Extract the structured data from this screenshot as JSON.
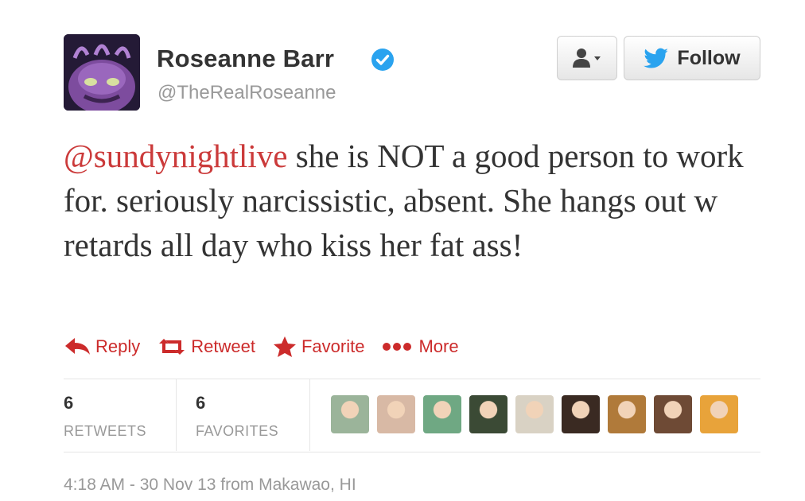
{
  "author": {
    "name": "Roseanne Barr",
    "handle": "@TheRealRoseanne",
    "verified": true,
    "avatar_icon": "purple-monster-avatar"
  },
  "buttons": {
    "user_menu_icon": "user-dropdown-icon",
    "follow_label": "Follow"
  },
  "tweet": {
    "mention": "@sundynightlive",
    "body": " she is NOT a good person to work for. seriously narcissistic, absent. She hangs out w retards all day who kiss her fat ass!"
  },
  "actions": [
    {
      "label": "Reply",
      "icon": "reply-icon"
    },
    {
      "label": "Retweet",
      "icon": "retweet-icon"
    },
    {
      "label": "Favorite",
      "icon": "star-icon"
    },
    {
      "label": "More",
      "icon": "more-dots-icon"
    }
  ],
  "stats": {
    "retweets": {
      "count": "6",
      "label": "RETWEETS"
    },
    "favorites": {
      "count": "6",
      "label": "FAVORITES"
    }
  },
  "favoriters": [
    {
      "name": "avatar-1",
      "color": "#9bb49a"
    },
    {
      "name": "avatar-2",
      "color": "#d8b9a5"
    },
    {
      "name": "avatar-3",
      "color": "#6fa883"
    },
    {
      "name": "avatar-4",
      "color": "#3b4a35"
    },
    {
      "name": "avatar-5",
      "color": "#d9d2c4"
    },
    {
      "name": "avatar-6",
      "color": "#3a2a22"
    },
    {
      "name": "avatar-7",
      "color": "#b07a3a"
    },
    {
      "name": "avatar-8",
      "color": "#6e4a35"
    },
    {
      "name": "avatar-9",
      "color": "#e8a33a"
    }
  ],
  "timestamp": "4:18 AM - 30 Nov 13 from Makawao, HI",
  "colors": {
    "accent": "#cc2b2b",
    "verified_blue": "#2aa3ef",
    "twitter_blue": "#2aa3ef",
    "muted": "#999999"
  }
}
